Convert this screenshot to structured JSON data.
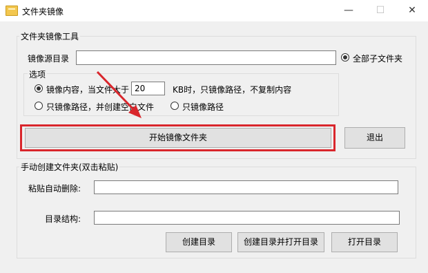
{
  "window": {
    "title": "文件夹镜像",
    "minimize": "—",
    "maximize": "☐",
    "close": "✕"
  },
  "mirror_group": {
    "title": "文件夹镜像工具",
    "source_label": "镜像源目录",
    "source_value": "",
    "all_subfolders_label": "全部子文件夹",
    "all_subfolders_checked": true,
    "options": {
      "title": "选项",
      "opt_content_prefix": "镜像内容，当文件大于",
      "size_value": "20",
      "opt_content_suffix": "KB时，只镜像路径，不复制内容",
      "opt_path_empty": "只镜像路径，并创建空白文件",
      "opt_path_only": "只镜像路径",
      "selected": "content"
    },
    "start_button": "开始镜像文件夹",
    "exit_button": "退出"
  },
  "manual_group": {
    "title": "手动创建文件夹(双击粘贴)",
    "paste_label": "粘贴自动删除:",
    "paste_value": "",
    "structure_label": "目录结构:",
    "structure_value": "",
    "create_dir_button": "创建目录",
    "create_open_button": "创建目录并打开目录",
    "open_dir_button": "打开目录"
  },
  "colors": {
    "highlight": "#d9262c",
    "arrow": "#d9262c"
  }
}
